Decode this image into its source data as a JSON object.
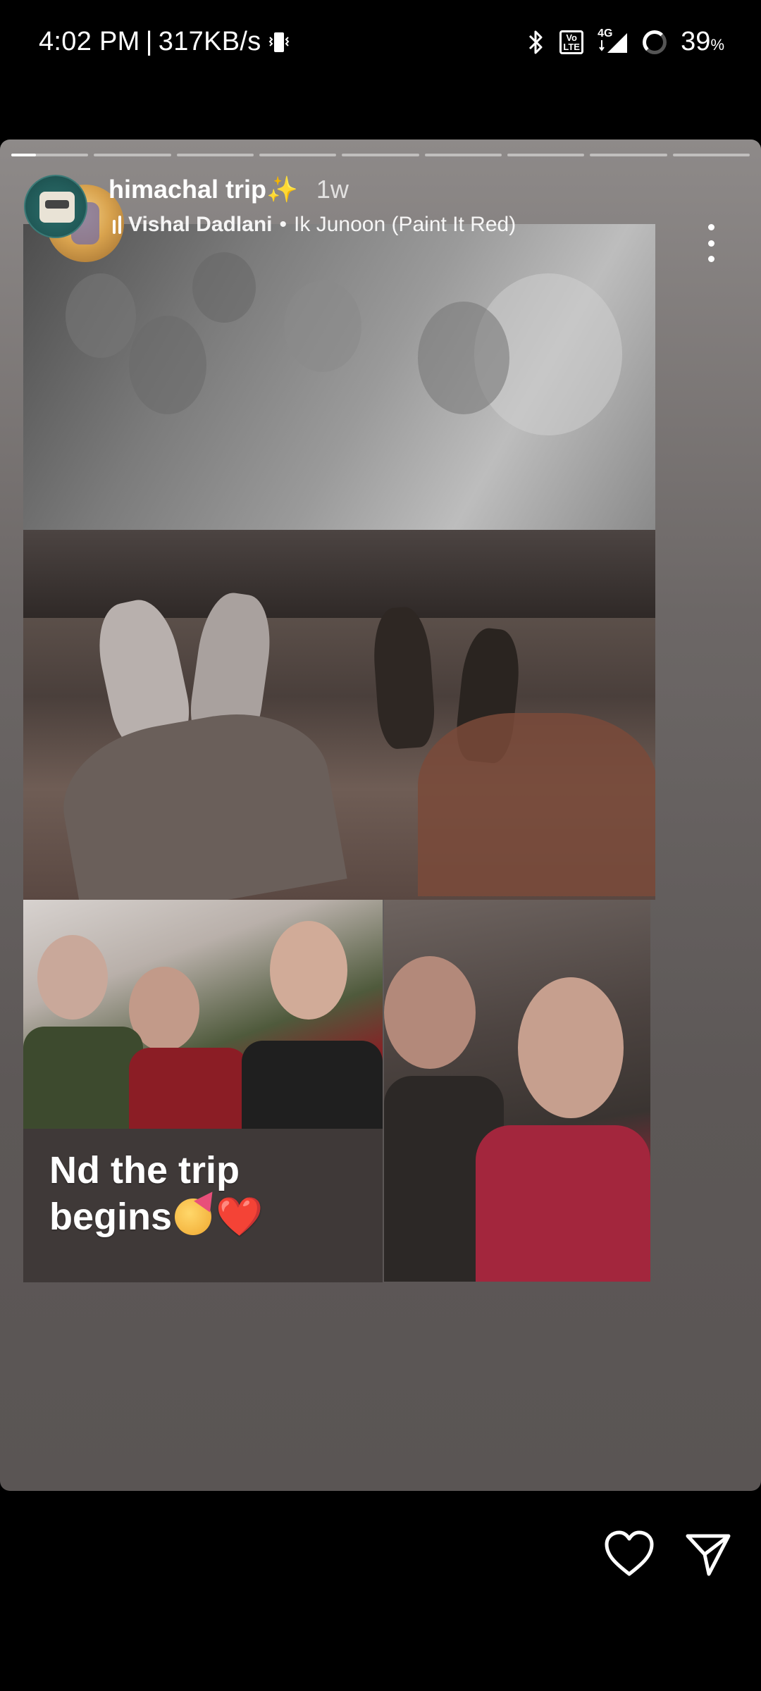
{
  "status_bar": {
    "time": "4:02 PM",
    "separator": "|",
    "speed": "317KB/s",
    "network": "4G",
    "battery": "39",
    "battery_unit": "%",
    "volte_label": "Vo LTE"
  },
  "story": {
    "segments": 9,
    "active_segment": 1,
    "active_progress": 0.32,
    "title": "himachal trip✨",
    "age": "1w",
    "music_artist": "Vishal Dadlani",
    "music_separator": "•",
    "music_track": "Ik Junoon (Paint It Red)",
    "caption_line1": "Nd the trip",
    "caption_line2": "begins",
    "caption_emoji_heart": "❤️"
  },
  "icons": {
    "more": "more-vertical-icon",
    "like": "heart-icon",
    "send": "send-icon"
  }
}
